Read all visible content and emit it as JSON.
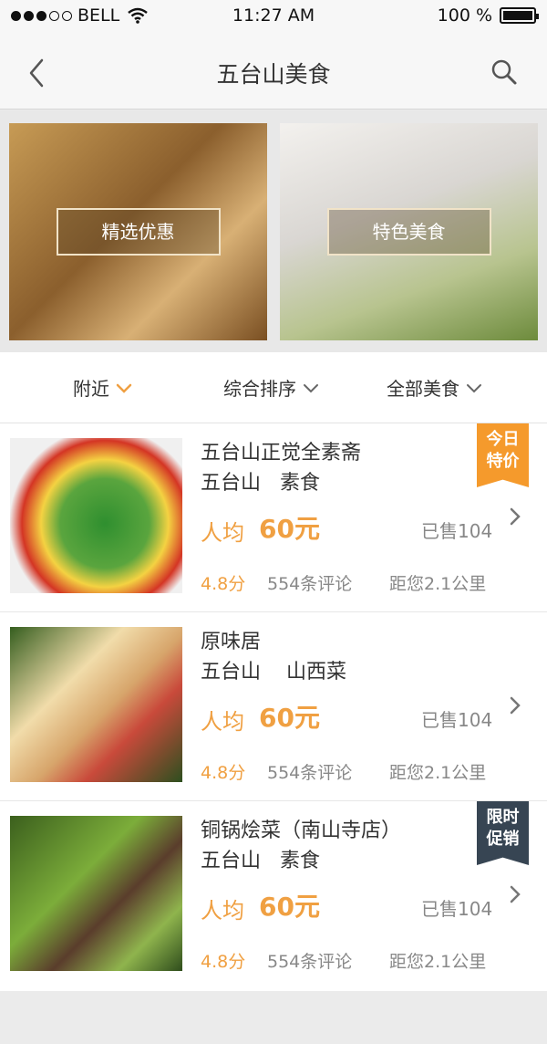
{
  "status_bar": {
    "carrier": "BELL",
    "time": "11:27 AM",
    "battery": "100 %",
    "signal_filled": 3,
    "signal_total": 5
  },
  "nav": {
    "title": "五台山美食",
    "back_icon": "chevron-left-icon",
    "search_icon": "search-icon"
  },
  "promos": [
    {
      "label": "精选优惠"
    },
    {
      "label": "特色美食"
    }
  ],
  "filters": [
    {
      "label": "附近",
      "icon": "chevron-down-icon",
      "active": true
    },
    {
      "label": "综合排序",
      "icon": "chevron-down-icon",
      "active": false
    },
    {
      "label": "全部美食",
      "icon": "chevron-down-icon",
      "active": false
    }
  ],
  "restaurants": [
    {
      "name": "五台山正觉全素斋",
      "subtitle": "五台山   素食",
      "price_label": "人均",
      "price": "60元",
      "sold": "已售104",
      "rating": "4.8分",
      "reviews": "554条评论",
      "distance": "距您2.1公里",
      "badge_line1": "今日",
      "badge_line2": "特价",
      "badge_color": "#f59a2c"
    },
    {
      "name": "原味居",
      "subtitle": "五台山    山西菜",
      "price_label": "人均",
      "price": "60元",
      "sold": "已售104",
      "rating": "4.8分",
      "reviews": "554条评论",
      "distance": "距您2.1公里"
    },
    {
      "name": "铜锅烩菜（南山寺店）",
      "subtitle": "五台山   素食",
      "price_label": "人均",
      "price": "60元",
      "sold": "已售104",
      "rating": "4.8分",
      "reviews": "554条评论",
      "distance": "距您2.1公里",
      "badge_line1": "限时",
      "badge_line2": "促销",
      "badge_color": "#374553"
    }
  ],
  "colors": {
    "accent": "#f0a042",
    "muted_text": "#888888",
    "badge_orange": "#f59a2c",
    "badge_slate": "#374553"
  }
}
